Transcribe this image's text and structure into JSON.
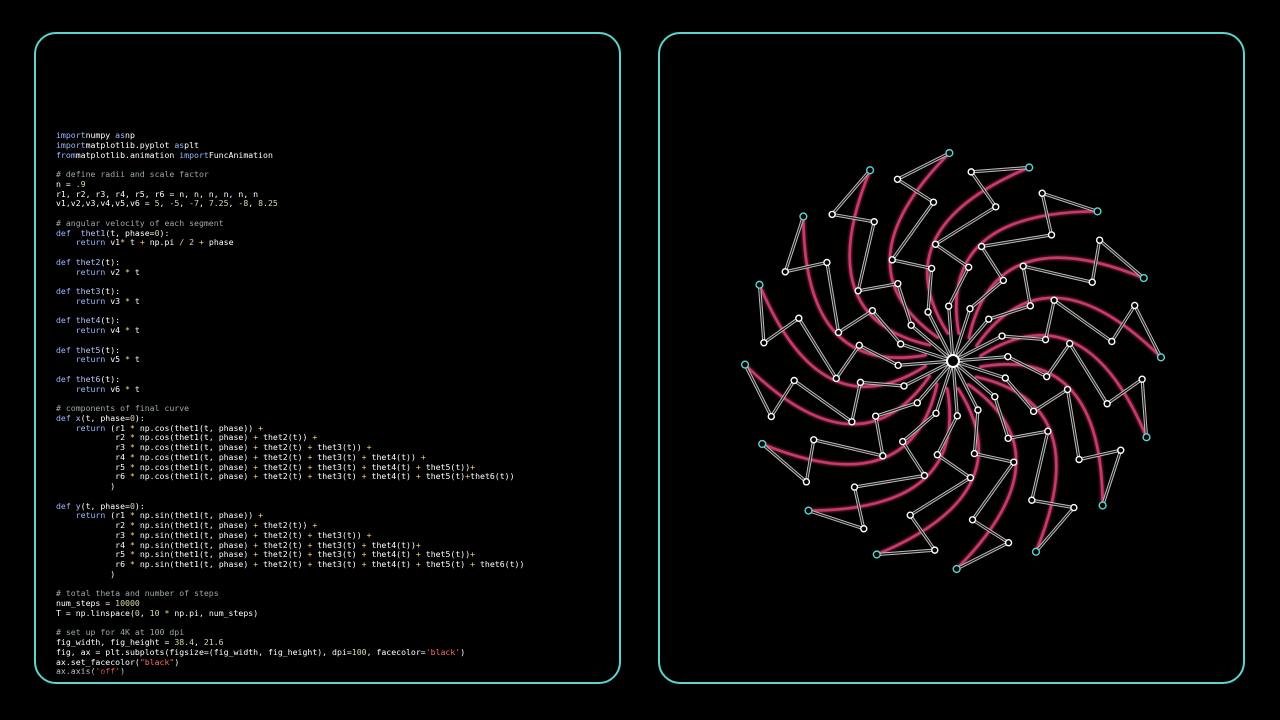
{
  "code_lines": [
    {
      "parts": [
        [
          "kw",
          "import"
        ],
        [
          "",
          "numpy "
        ],
        [
          "kw",
          "as"
        ],
        [
          "",
          "np"
        ]
      ]
    },
    {
      "parts": [
        [
          "kw",
          "import"
        ],
        [
          "",
          "matplotlib.pyplot "
        ],
        [
          "kw",
          "as"
        ],
        [
          "",
          "plt"
        ]
      ]
    },
    {
      "parts": [
        [
          "kw",
          "from"
        ],
        [
          "",
          "matplotlib.animation "
        ],
        [
          "kw",
          "import"
        ],
        [
          "",
          "FuncAnimation"
        ]
      ]
    },
    {
      "parts": []
    },
    {
      "parts": [
        [
          "cm",
          "# define radii and scale factor"
        ]
      ]
    },
    {
      "parts": [
        [
          "",
          "n = "
        ],
        [
          "num",
          ".9"
        ]
      ]
    },
    {
      "parts": [
        [
          "",
          "r1, r2, r3, r4, r5, r6 = n, n, n, n, n, n"
        ]
      ]
    },
    {
      "parts": [
        [
          "",
          "v1,v2,v3,v4,v5,v6 = "
        ],
        [
          "num",
          "5"
        ],
        [
          "",
          ", "
        ],
        [
          "num",
          "-5"
        ],
        [
          "",
          ", "
        ],
        [
          "num",
          "-7"
        ],
        [
          "",
          ", "
        ],
        [
          "num",
          "7.25"
        ],
        [
          "",
          ", "
        ],
        [
          "num",
          "-8"
        ],
        [
          "",
          ", "
        ],
        [
          "num",
          "8.25"
        ]
      ]
    },
    {
      "parts": []
    },
    {
      "parts": [
        [
          "cm",
          "# angular velocity of each segment"
        ]
      ]
    },
    {
      "parts": [
        [
          "kw",
          "def"
        ],
        [
          "",
          "  "
        ],
        [
          "fn",
          "thet1"
        ],
        [
          "",
          "(t, phase="
        ],
        [
          "num",
          "0"
        ],
        [
          "",
          "):"
        ]
      ]
    },
    {
      "parts": [
        [
          "",
          "    "
        ],
        [
          "kw",
          "return"
        ],
        [
          "",
          " v1"
        ],
        [
          "op",
          "*"
        ],
        [
          "",
          " t "
        ],
        [
          "op",
          "+"
        ],
        [
          "",
          " np.pi "
        ],
        [
          "op",
          "/"
        ],
        [
          "",
          " "
        ],
        [
          "num",
          "2"
        ],
        [
          "",
          " "
        ],
        [
          "op",
          "+"
        ],
        [
          "",
          " phase"
        ]
      ]
    },
    {
      "parts": []
    },
    {
      "parts": [
        [
          "kw",
          "def"
        ],
        [
          "",
          ""
        ],
        [
          "fn",
          " thet2"
        ],
        [
          "",
          "(t):"
        ]
      ]
    },
    {
      "parts": [
        [
          "",
          "    "
        ],
        [
          "kw",
          "return"
        ],
        [
          "",
          " v2 "
        ],
        [
          "op",
          "*"
        ],
        [
          "",
          " t"
        ]
      ]
    },
    {
      "parts": []
    },
    {
      "parts": [
        [
          "kw",
          "def"
        ],
        [
          "fn",
          " thet3"
        ],
        [
          "",
          "(t):"
        ]
      ]
    },
    {
      "parts": [
        [
          "",
          "    "
        ],
        [
          "kw",
          "return"
        ],
        [
          "",
          " v3 "
        ],
        [
          "op",
          "*"
        ],
        [
          "",
          " t"
        ]
      ]
    },
    {
      "parts": []
    },
    {
      "parts": [
        [
          "kw",
          "def"
        ],
        [
          "fn",
          " thet4"
        ],
        [
          "",
          "(t):"
        ]
      ]
    },
    {
      "parts": [
        [
          "",
          "    "
        ],
        [
          "kw",
          "return"
        ],
        [
          "",
          " v4 "
        ],
        [
          "op",
          "*"
        ],
        [
          "",
          " t"
        ]
      ]
    },
    {
      "parts": []
    },
    {
      "parts": [
        [
          "kw",
          "def"
        ],
        [
          "fn",
          " thet5"
        ],
        [
          "",
          "(t):"
        ]
      ]
    },
    {
      "parts": [
        [
          "",
          "    "
        ],
        [
          "kw",
          "return"
        ],
        [
          "",
          " v5 "
        ],
        [
          "op",
          "*"
        ],
        [
          "",
          " t"
        ]
      ]
    },
    {
      "parts": []
    },
    {
      "parts": [
        [
          "kw",
          "def"
        ],
        [
          "fn",
          " thet6"
        ],
        [
          "",
          "(t):"
        ]
      ]
    },
    {
      "parts": [
        [
          "",
          "    "
        ],
        [
          "kw",
          "return"
        ],
        [
          "",
          " v6 "
        ],
        [
          "op",
          "*"
        ],
        [
          "",
          " t"
        ]
      ]
    },
    {
      "parts": []
    },
    {
      "parts": [
        [
          "cm",
          "# components of final curve"
        ]
      ]
    },
    {
      "parts": [
        [
          "kw",
          "def"
        ],
        [
          "fn",
          " x"
        ],
        [
          "",
          "(t, phase="
        ],
        [
          "num",
          "0"
        ],
        [
          "",
          "):"
        ]
      ]
    },
    {
      "parts": [
        [
          "",
          "    "
        ],
        [
          "kw",
          "return"
        ],
        [
          "",
          " (r1 "
        ],
        [
          "op",
          "*"
        ],
        [
          "",
          " np.cos(thet1(t, phase)) "
        ],
        [
          "op",
          "+"
        ]
      ]
    },
    {
      "parts": [
        [
          "",
          "            r2 "
        ],
        [
          "op",
          "*"
        ],
        [
          "",
          " np.cos(thet1(t, phase) "
        ],
        [
          "op",
          "+"
        ],
        [
          "",
          " thet2(t)) "
        ],
        [
          "op",
          "+"
        ]
      ]
    },
    {
      "parts": [
        [
          "",
          "            r3 "
        ],
        [
          "op",
          "*"
        ],
        [
          "",
          " np.cos(thet1(t, phase) "
        ],
        [
          "op",
          "+"
        ],
        [
          "",
          " thet2(t) "
        ],
        [
          "op",
          "+"
        ],
        [
          "",
          " thet3(t)) "
        ],
        [
          "op",
          "+"
        ]
      ]
    },
    {
      "parts": [
        [
          "",
          "            r4 "
        ],
        [
          "op",
          "*"
        ],
        [
          "",
          " np.cos(thet1(t, phase) "
        ],
        [
          "op",
          "+"
        ],
        [
          "",
          " thet2(t) "
        ],
        [
          "op",
          "+"
        ],
        [
          "",
          " thet3(t) "
        ],
        [
          "op",
          "+"
        ],
        [
          "",
          " thet4(t)) "
        ],
        [
          "op",
          "+"
        ]
      ]
    },
    {
      "parts": [
        [
          "",
          "            r5 "
        ],
        [
          "op",
          "*"
        ],
        [
          "",
          " np.cos(thet1(t, phase) "
        ],
        [
          "op",
          "+"
        ],
        [
          "",
          " thet2(t) "
        ],
        [
          "op",
          "+"
        ],
        [
          "",
          " thet3(t) "
        ],
        [
          "op",
          "+"
        ],
        [
          "",
          " thet4(t) "
        ],
        [
          "op",
          "+"
        ],
        [
          "",
          " thet5(t))"
        ],
        [
          "op",
          "+"
        ]
      ]
    },
    {
      "parts": [
        [
          "",
          "            r6 "
        ],
        [
          "op",
          "*"
        ],
        [
          "",
          " np.cos(thet1(t, phase) "
        ],
        [
          "op",
          "+"
        ],
        [
          "",
          " thet2(t) "
        ],
        [
          "op",
          "+"
        ],
        [
          "",
          " thet3(t) "
        ],
        [
          "op",
          "+"
        ],
        [
          "",
          " thet4(t) "
        ],
        [
          "op",
          "+"
        ],
        [
          "",
          " thet5(t)"
        ],
        [
          "op",
          "+"
        ],
        [
          "",
          "thet6(t))"
        ]
      ]
    },
    {
      "parts": [
        [
          "",
          "           )"
        ]
      ]
    },
    {
      "parts": []
    },
    {
      "parts": [
        [
          "kw",
          "def"
        ],
        [
          "fn",
          " y"
        ],
        [
          "",
          "(t, phase="
        ],
        [
          "num",
          "0"
        ],
        [
          "",
          "):"
        ]
      ]
    },
    {
      "parts": [
        [
          "",
          "    "
        ],
        [
          "kw",
          "return"
        ],
        [
          "",
          " (r1 "
        ],
        [
          "op",
          "*"
        ],
        [
          "",
          " np.sin(thet1(t, phase)) "
        ],
        [
          "op",
          "+"
        ]
      ]
    },
    {
      "parts": [
        [
          "",
          "            r2 "
        ],
        [
          "op",
          "*"
        ],
        [
          "",
          " np.sin(thet1(t, phase) "
        ],
        [
          "op",
          "+"
        ],
        [
          "",
          " thet2(t)) "
        ],
        [
          "op",
          "+"
        ]
      ]
    },
    {
      "parts": [
        [
          "",
          "            r3 "
        ],
        [
          "op",
          "*"
        ],
        [
          "",
          " np.sin(thet1(t, phase) "
        ],
        [
          "op",
          "+"
        ],
        [
          "",
          " thet2(t) "
        ],
        [
          "op",
          "+"
        ],
        [
          "",
          " thet3(t)) "
        ],
        [
          "op",
          "+"
        ]
      ]
    },
    {
      "parts": [
        [
          "",
          "            r4 "
        ],
        [
          "op",
          "*"
        ],
        [
          "",
          " np.sin(thet1(t, phase) "
        ],
        [
          "op",
          "+"
        ],
        [
          "",
          " thet2(t) "
        ],
        [
          "op",
          "+"
        ],
        [
          "",
          " thet3(t) "
        ],
        [
          "op",
          "+"
        ],
        [
          "",
          " thet4(t))"
        ],
        [
          "op",
          "+"
        ]
      ]
    },
    {
      "parts": [
        [
          "",
          "            r5 "
        ],
        [
          "op",
          "*"
        ],
        [
          "",
          " np.sin(thet1(t, phase) "
        ],
        [
          "op",
          "+"
        ],
        [
          "",
          " thet2(t) "
        ],
        [
          "op",
          "+"
        ],
        [
          "",
          " thet3(t) "
        ],
        [
          "op",
          "+"
        ],
        [
          "",
          " thet4(t) "
        ],
        [
          "op",
          "+"
        ],
        [
          "",
          " thet5(t))"
        ],
        [
          "op",
          "+"
        ]
      ]
    },
    {
      "parts": [
        [
          "",
          "            r6 "
        ],
        [
          "op",
          "*"
        ],
        [
          "",
          " np.sin(thet1(t, phase) "
        ],
        [
          "op",
          "+"
        ],
        [
          "",
          " thet2(t) "
        ],
        [
          "op",
          "+"
        ],
        [
          "",
          " thet3(t) "
        ],
        [
          "op",
          "+"
        ],
        [
          "",
          " thet4(t) "
        ],
        [
          "op",
          "+"
        ],
        [
          "",
          " thet5(t) "
        ],
        [
          "op",
          "+"
        ],
        [
          "",
          " thet6(t))"
        ]
      ]
    },
    {
      "parts": [
        [
          "",
          "           )"
        ]
      ]
    },
    {
      "parts": []
    },
    {
      "parts": [
        [
          "cm",
          "# total theta and number of steps"
        ]
      ]
    },
    {
      "parts": [
        [
          "",
          "num_steps = "
        ],
        [
          "num",
          "10000"
        ]
      ]
    },
    {
      "parts": [
        [
          "",
          "T = np.linspace("
        ],
        [
          "num",
          "0"
        ],
        [
          "",
          ", "
        ],
        [
          "num",
          "10"
        ],
        [
          "",
          " "
        ],
        [
          "op",
          "*"
        ],
        [
          "",
          " np.pi, num_steps)"
        ]
      ]
    },
    {
      "parts": []
    },
    {
      "parts": [
        [
          "cm",
          "# set up for 4K at 100 dpi"
        ]
      ]
    },
    {
      "parts": [
        [
          "",
          "fig_width, fig_height = "
        ],
        [
          "num",
          "38.4"
        ],
        [
          "",
          ", "
        ],
        [
          "num",
          "21.6"
        ]
      ]
    },
    {
      "parts": [
        [
          "",
          "fig, ax = plt.subplots(figsize=(fig_width, fig_height), dpi="
        ],
        [
          "num",
          "100"
        ],
        [
          "",
          ", facecolor="
        ],
        [
          "str",
          "'black'"
        ],
        [
          "",
          ")"
        ]
      ]
    },
    {
      "parts": [
        [
          "",
          "ax.set_facecolor("
        ],
        [
          "str",
          "\"black\""
        ],
        [
          "",
          ")"
        ]
      ]
    },
    {
      "parts": [
        [
          "",
          "ax.axis("
        ],
        [
          "str",
          "'off'"
        ],
        [
          "",
          ")"
        ]
      ]
    }
  ],
  "visualization": {
    "arm_count": 16,
    "trail_color": "#e0407a",
    "trail_tip_color": "#9b7de8",
    "link_color": "#bdbdbd",
    "joint_color": "#ffffff",
    "tip_ring_color": "#5ad6cf",
    "panel_border_color": "#5ad6cf"
  }
}
